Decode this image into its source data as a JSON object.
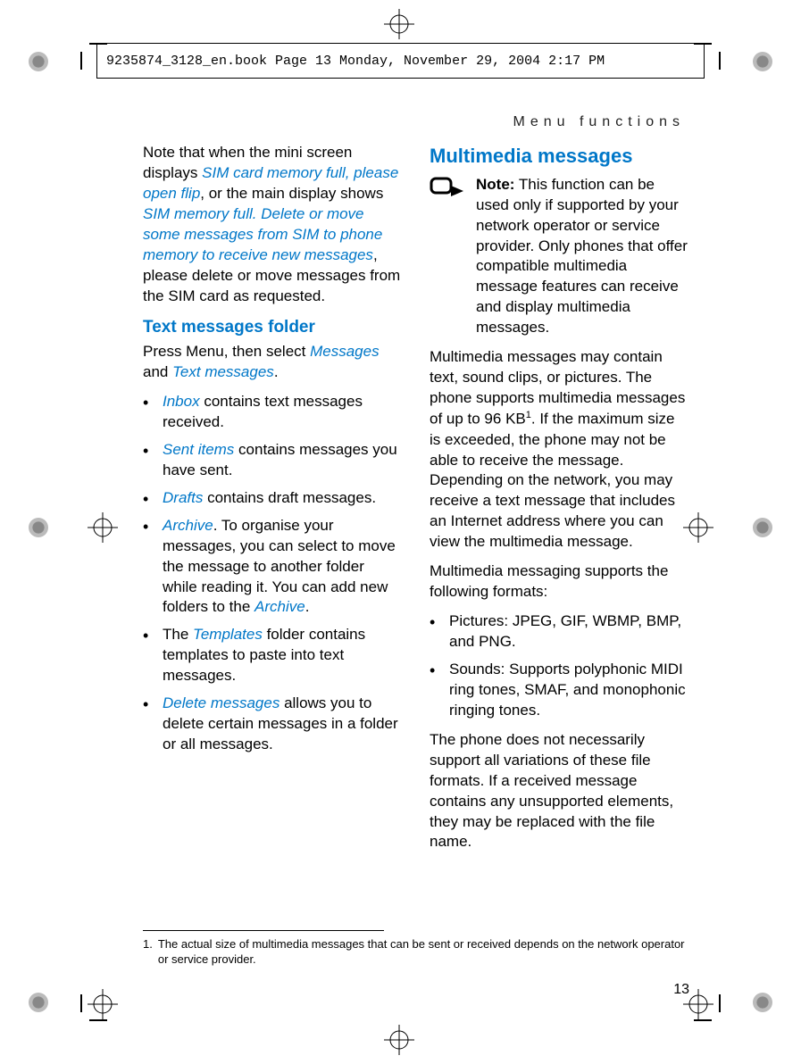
{
  "header_line": "9235874_3128_en.book  Page 13  Monday, November 29, 2004  2:17 PM",
  "running_head": "Menu functions",
  "page_number": "13",
  "left": {
    "intro": {
      "t1": "Note that when the mini screen displays ",
      "i1": "SIM card memory full, please open flip",
      "t2": ", or the main display shows ",
      "i2": "SIM memory full. Delete or move some messages from SIM to phone memory to receive new messages",
      "t3": ", please delete or move messages from the SIM card as requested."
    },
    "heading": "Text messages folder",
    "press": {
      "t1": "Press Menu, then select ",
      "i1": "Messages",
      "t2": " and ",
      "i2": "Text messages",
      "t3": "."
    },
    "items": {
      "inbox": {
        "lbl": "Inbox",
        "rest": " contains text messages received."
      },
      "sent": {
        "lbl": "Sent items",
        "rest": " contains messages you have sent."
      },
      "drafts": {
        "lbl": "Drafts",
        "rest": " contains draft messages."
      },
      "archive": {
        "lbl": "Archive",
        "t1": ". To organise your messages, you can select to move the message to another folder while reading it. You can add new folders to the ",
        "lbl2": "Archive",
        "t2": "."
      },
      "templates": {
        "t1": "The ",
        "lbl": "Templates",
        "t2": " folder contains templates to paste into text messages."
      },
      "delete": {
        "lbl": "Delete messages",
        "rest": " allows you to delete certain messages in a folder or all messages."
      }
    }
  },
  "right": {
    "heading": "Multimedia messages",
    "note": {
      "label": "Note:",
      "body": " This function can be used only if supported by your network operator or service provider. Only phones that offer compatible multimedia message features can receive and display multimedia messages."
    },
    "para1": {
      "t1": "Multimedia messages may contain text, sound clips, or pictures. The phone supports multimedia messages of up to 96 KB",
      "sup": "1",
      "t2": ". If the maximum size is exceeded, the phone may not be able to receive the message. Depending on the network, you may receive a text message that includes an Internet address where you can view the multimedia message."
    },
    "para2": "Multimedia messaging supports the following formats:",
    "formats": {
      "pictures": "Pictures: JPEG, GIF, WBMP, BMP, and PNG.",
      "sounds": "Sounds: Supports polyphonic MIDI ring tones, SMAF, and monophonic ringing tones."
    },
    "para3": "The phone does not necessarily support all variations of these file formats. If a received message contains any unsupported elements, they may be replaced with the file name."
  },
  "footnote": {
    "num": "1.",
    "text": "The actual size of multimedia messages that can be sent or received depends on the network operator or service provider."
  }
}
